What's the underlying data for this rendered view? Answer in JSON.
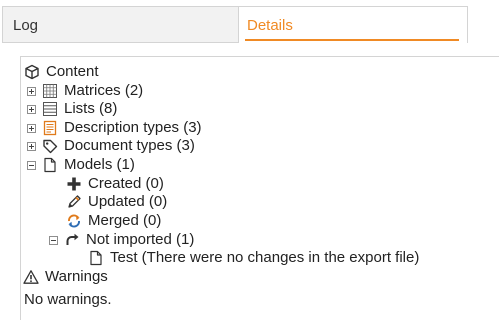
{
  "tabs": {
    "log_label": "Log",
    "details_label": "Details",
    "active": "Details",
    "accent_color": "#f08a24"
  },
  "tree": {
    "root_label": "Content",
    "matrices_label": "Matrices (2)",
    "lists_label": "Lists (8)",
    "description_types_label": "Description types (3)",
    "document_types_label": "Document types (3)",
    "models_label": "Models (1)",
    "created_label": "Created (0)",
    "updated_label": "Updated (0)",
    "merged_label": "Merged (0)",
    "not_imported_label": "Not imported (1)",
    "test_label": "Test (There were no changes in the export file)"
  },
  "warnings": {
    "title": "Warnings",
    "message": "No warnings."
  },
  "icons": {
    "content": "cube-icon",
    "matrices": "grid-icon",
    "lists": "list-icon",
    "description_types": "form-icon",
    "document_types": "tag-icon",
    "models": "document-icon",
    "created": "plus-icon",
    "updated": "pencil-icon",
    "merged": "merge-arrows-icon",
    "not_imported": "redo-arrow-icon",
    "test": "document-icon",
    "warnings": "warning-triangle-icon"
  }
}
